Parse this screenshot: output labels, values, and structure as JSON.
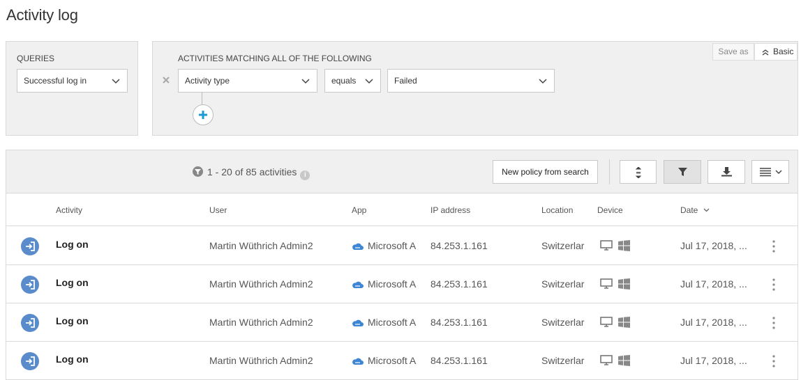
{
  "page": {
    "title": "Activity log"
  },
  "queries": {
    "label": "QUERIES",
    "selected": "Successful log in"
  },
  "filters": {
    "label": "ACTIVITIES MATCHING ALL OF THE FOLLOWING",
    "save_as": "Save as",
    "basic": "Basic",
    "condition": {
      "field": "Activity type",
      "operator": "equals",
      "value": "Failed"
    }
  },
  "toolbar": {
    "count_text": "1 - 20 of 85 activities",
    "info_glyph": "i",
    "new_policy_label": "New policy from search"
  },
  "columns": {
    "activity": "Activity",
    "user": "User",
    "app": "App",
    "ip": "IP address",
    "location": "Location",
    "device": "Device",
    "date": "Date"
  },
  "rows": [
    {
      "activity": "Log on",
      "user": "Martin Wüthrich Admin2",
      "app": "Microsoft A",
      "ip": "84.253.1.161",
      "location": "Switzerlar",
      "date": "Jul 17, 2018, ..."
    },
    {
      "activity": "Log on",
      "user": "Martin Wüthrich Admin2",
      "app": "Microsoft A",
      "ip": "84.253.1.161",
      "location": "Switzerlar",
      "date": "Jul 17, 2018, ..."
    },
    {
      "activity": "Log on",
      "user": "Martin Wüthrich Admin2",
      "app": "Microsoft A",
      "ip": "84.253.1.161",
      "location": "Switzerlar",
      "date": "Jul 17, 2018, ..."
    },
    {
      "activity": "Log on",
      "user": "Martin Wüthrich Admin2",
      "app": "Microsoft A",
      "ip": "84.253.1.161",
      "location": "Switzerlar",
      "date": "Jul 17, 2018, ..."
    }
  ],
  "icons": {
    "chevron": "chevron-down-icon",
    "remove": "close-icon",
    "add": "plus-icon",
    "activity": "log-on-icon",
    "app": "cloud-icon",
    "device_monitor": "monitor-icon",
    "device_os": "windows-icon",
    "more": "more-vertical-icon"
  },
  "colors": {
    "accent": "#0078d4",
    "activity_icon_bg": "#5a8ccb",
    "panel_bg": "#f0f0f0"
  }
}
